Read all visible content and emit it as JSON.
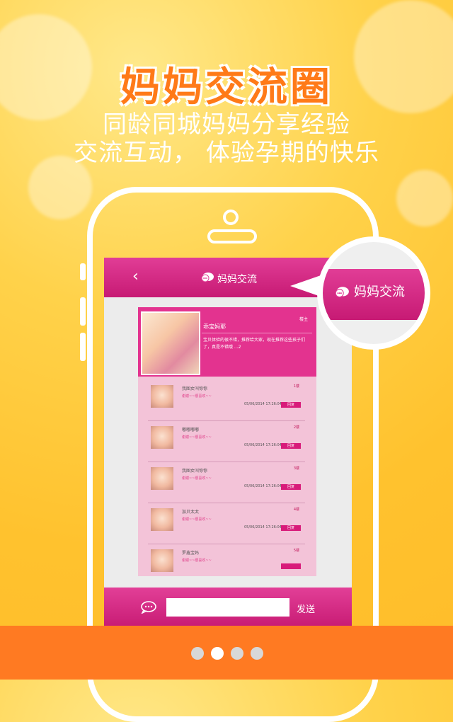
{
  "hero": {
    "title": "妈妈交流圈",
    "subtitle_line1": "同龄同城妈妈分享经验",
    "subtitle_line2": "交流互动，  体验孕期的快乐"
  },
  "nav": {
    "back_icon": "back-chevron-icon",
    "title": "妈妈交流",
    "icon": "chat-bubble-icon"
  },
  "post": {
    "author": "乖宝妈耶",
    "tag": "楼主",
    "body": "宝贝体验的很不错，推荐给大家，现在推荐这些孩子们了，真是不错哦 ...2"
  },
  "replies": [
    {
      "name": "我图女叫惊惊",
      "msg": "谢谢~~很喜欢~~",
      "floor": "1楼",
      "time": "05/06/2014  17:26:04",
      "btn": "回复"
    },
    {
      "name": "嘟嘟嘟嘟",
      "msg": "谢谢~~很喜欢~~",
      "floor": "2楼",
      "time": "05/06/2014  17:26:04",
      "btn": "回复"
    },
    {
      "name": "我图女叫惊惊",
      "msg": "谢谢~~很喜欢~~",
      "floor": "3楼",
      "time": "05/06/2014  17:26:04",
      "btn": "回复"
    },
    {
      "name": "加贝太太",
      "msg": "谢谢~~很喜欢~~",
      "floor": "4楼",
      "time": "05/06/2014  17:26:04",
      "btn": "回复"
    },
    {
      "name": "罗鑫宝妈",
      "msg": "谢谢~~很喜欢~~",
      "floor": "5楼",
      "time": "",
      "btn": ""
    }
  ],
  "composer": {
    "icon": "chat-bubble-icon",
    "placeholder": "",
    "send_label": "发送"
  },
  "callout": {
    "label": "妈妈交流",
    "icon": "chat-bubble-icon"
  },
  "pager": {
    "count": 4,
    "active_index": 1
  },
  "colors": {
    "accent_pink": "#d81b7a",
    "background_yellow": "#ffc22e",
    "footer_orange": "#ff7a22",
    "title_orange": "#ff7a18"
  }
}
